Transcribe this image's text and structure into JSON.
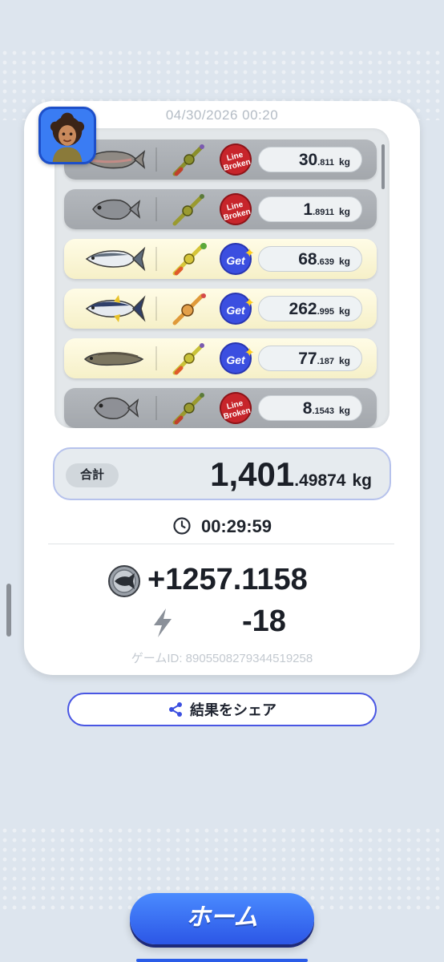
{
  "result": {
    "timestamp": "04/30/2026 00:20",
    "catches": [
      {
        "fish": "salmon-icon",
        "status": "broken",
        "badge_line1": "Line",
        "badge_line2": "Broken",
        "weight_int": "30",
        "weight_dec": ".811",
        "unit": "kg"
      },
      {
        "fish": "snapper-icon",
        "status": "broken",
        "badge_line1": "Line",
        "badge_line2": "Broken",
        "weight_int": "1",
        "weight_dec": ".8911",
        "unit": "kg"
      },
      {
        "fish": "amberjack-icon",
        "status": "got",
        "badge": "Get",
        "weight_int": "68",
        "weight_dec": ".639",
        "unit": "kg"
      },
      {
        "fish": "tuna-icon",
        "status": "got",
        "badge": "Get",
        "weight_int": "262",
        "weight_dec": ".995",
        "unit": "kg"
      },
      {
        "fish": "snakehead-icon",
        "status": "got",
        "badge": "Get",
        "weight_int": "77",
        "weight_dec": ".187",
        "unit": "kg"
      },
      {
        "fish": "piranha-icon",
        "status": "broken",
        "badge_line1": "Line",
        "badge_line2": "Broken",
        "weight_int": "8",
        "weight_dec": ".1543",
        "unit": "kg"
      }
    ],
    "total": {
      "label": "合計",
      "int": "1,401",
      "dec": ".49874",
      "unit": "kg"
    },
    "elapsed": "00:29:59",
    "reward": "+1257.1158",
    "energy": "-18",
    "game_id": "ゲームID: 8905508279344519258"
  },
  "actions": {
    "share_label": "結果をシェア",
    "home_label": "ホーム"
  },
  "colors": {
    "accent": "#3b4fe0",
    "broken": "#c7252b",
    "got_row": "#fffce6",
    "broken_row": "#b4b8bd"
  }
}
